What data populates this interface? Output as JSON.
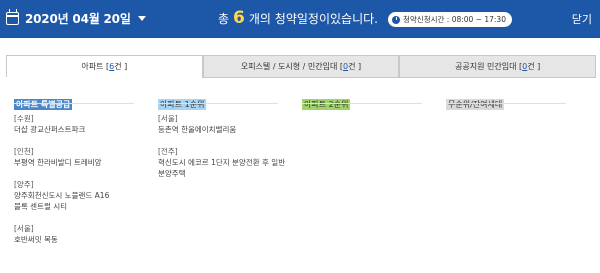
{
  "header": {
    "date": "2020년 04월 20일",
    "summary_prefix": "총",
    "count": "6",
    "summary_suffix": "개의 청약일정이있습니다.",
    "hours": "청약신청시간 : 08:00 ~ 17:30",
    "close_label": "닫기",
    "colors": {
      "bar": "#1c57a8",
      "count": "#ffd84a"
    }
  },
  "tabs": [
    {
      "prefix": "아파트 [ ",
      "count": "6",
      "suffix": "건 ]"
    },
    {
      "prefix": "오피스텔 / 도시형 / 민간임대 [ ",
      "count": "0",
      "suffix": "건 ]"
    },
    {
      "prefix": "공공지원 민간임대 [ ",
      "count": "0",
      "suffix": "건 ]"
    }
  ],
  "columns": [
    {
      "heading": "아파트 특별공급",
      "items": [
        {
          "region": "[수원]",
          "name": "더샵 광교산퍼스트파크"
        },
        {
          "region": "[인천]",
          "name": "부평역 한라비발디 트레비앙"
        },
        {
          "region": "[양주]",
          "name": "양주회천신도시 노블랜드 A16블록 센트럴 시티"
        },
        {
          "region": "[서울]",
          "name": "호반써밋 목동"
        }
      ]
    },
    {
      "heading": "아파트 1순위",
      "items": [
        {
          "region": "[서울]",
          "name": "등촌역 한울에이치밸리움"
        },
        {
          "region": "[전주]",
          "name": "혁신도시 에코르 1단지 분양전환 후 일반분양주택"
        }
      ]
    },
    {
      "heading": "아파트 2순위",
      "items": []
    },
    {
      "heading": "무순위/잔여세대",
      "items": []
    }
  ]
}
